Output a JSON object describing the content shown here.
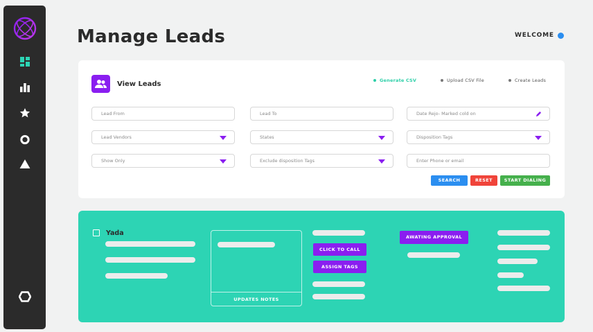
{
  "sidebar": {
    "icons": [
      "globe-logo-icon",
      "dashboard-icon",
      "bar-chart-icon",
      "star-icon",
      "circle-icon",
      "triangle-icon",
      "hexagon-icon"
    ]
  },
  "header": {
    "title": "Manage Leads",
    "welcome": "WELCOME"
  },
  "view_leads": {
    "title": "View Leads",
    "links": [
      "Generate CSV",
      "Upload CSV File",
      "Create Leads"
    ],
    "fields": {
      "lead_from": "Lead From",
      "lead_to": "Lead To",
      "date_field": "Date Rejo- Marked cold on",
      "lead_vendors": "Lead Vendors",
      "states": "States",
      "disposition_tags": "Disposition Tags",
      "show_only": "Show Only",
      "exclude_tags": "Exclude disposition Tags",
      "phone_email": "Enter Phone or email"
    },
    "buttons": {
      "search": "SEARCH",
      "reset": "RESET",
      "start_dialing": "START DIALING"
    }
  },
  "lead": {
    "name": "Yada",
    "updates_notes": "UPDATES NOTES",
    "click_to_call": "CLICK TO CALL",
    "assign_tags": "ASSIGN TAGS",
    "status": "AWATING APPROVAL"
  },
  "colors": {
    "accent_purple": "#8a1ef0",
    "teal": "#2dd4b4",
    "search_blue": "#2b8ef0",
    "reset_red": "#f0443a",
    "dial_green": "#45b04c"
  }
}
